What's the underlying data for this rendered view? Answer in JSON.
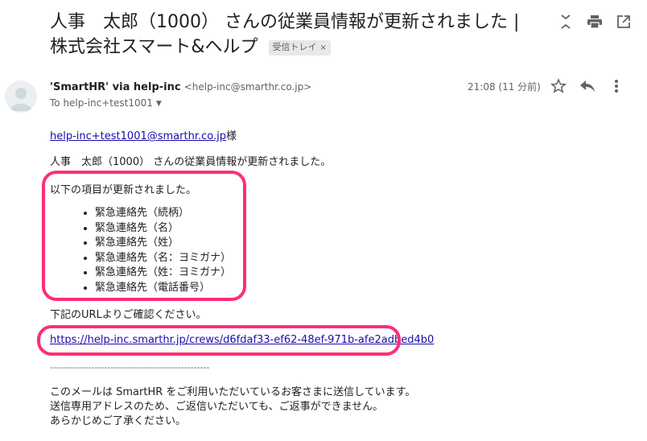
{
  "email": {
    "subject": "人事　太郎（1000） さんの従業員情報が更新されました | 株式会社スマート&ヘルプ",
    "label": "受信トレイ",
    "label_close": "×",
    "sender_name": "'SmartHR' via help-inc",
    "sender_address": "<help-inc@smarthr.co.jp>",
    "to": "To help-inc+test1001",
    "time": "21:08 (11 分前)"
  },
  "body": {
    "greeting_link": "help-inc+test1001@smarthr.co.jp",
    "greeting_suffix": "様",
    "intro": "人事　太郎（1000） さんの従業員情報が更新されました。",
    "items_header": "以下の項目が更新されました。",
    "items": [
      "緊急連絡先（続柄）",
      "緊急連絡先（名）",
      "緊急連絡先（姓）",
      "緊急連絡先（名：ヨミガナ）",
      "緊急連絡先（姓：ヨミガナ）",
      "緊急連絡先（電話番号）"
    ],
    "url_prompt": "下記のURLよりご確認ください。",
    "url": "https://help-inc.smarthr.jp/crews/d6fdaf33-ef62-48ef-971b-afe2adbed4b0",
    "divider": "--------------------------------------------------",
    "footer_1": "このメールは SmartHR をご利用いただいているお客さまに送信しています。",
    "footer_2": "送信専用アドレスのため、ご返信いただいても、ご返事ができません。",
    "footer_3": "あらかじめご了承ください。"
  },
  "colors": {
    "highlight": "#ff2d7c",
    "link": "#1a0dab"
  },
  "icons": [
    "expand-collapse-icon",
    "print-icon",
    "open-new-window-icon",
    "star-icon",
    "reply-icon",
    "more-vert-icon",
    "caret-down-icon"
  ]
}
